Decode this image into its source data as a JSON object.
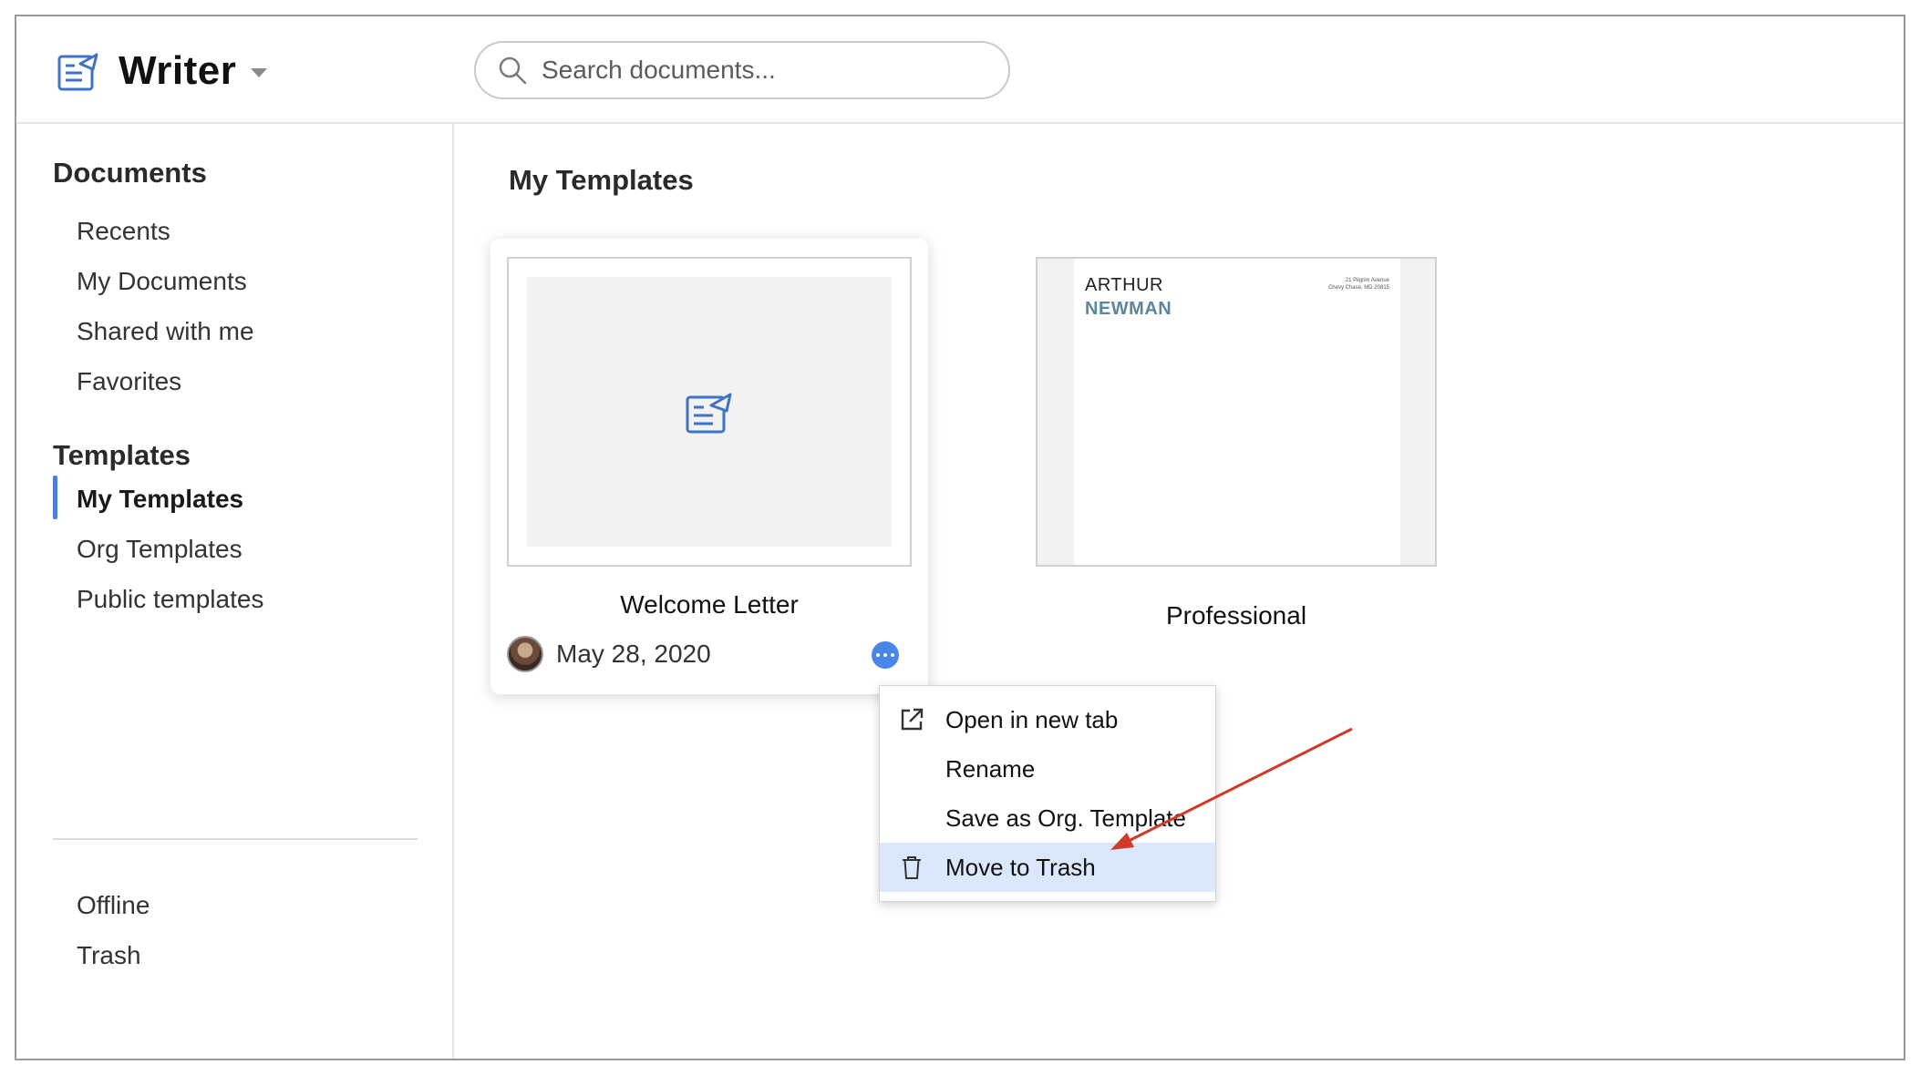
{
  "app": {
    "title": "Writer",
    "accent_color": "#4a7fd6"
  },
  "search": {
    "placeholder": "Search documents..."
  },
  "sidebar": {
    "documents_heading": "Documents",
    "documents_items": [
      {
        "label": "Recents"
      },
      {
        "label": "My Documents"
      },
      {
        "label": "Shared with me"
      },
      {
        "label": "Favorites"
      }
    ],
    "templates_heading": "Templates",
    "templates_items": [
      {
        "label": "My Templates",
        "active": true
      },
      {
        "label": "Org Templates"
      },
      {
        "label": "Public templates"
      }
    ],
    "other_items": [
      {
        "label": "Offline"
      },
      {
        "label": "Trash"
      }
    ]
  },
  "main": {
    "title": "My Templates",
    "cards": [
      {
        "name": "Welcome Letter",
        "date": "May 28, 2020",
        "icon": "document-icon"
      },
      {
        "name": "Professional",
        "preview": {
          "first_name": "ARTHUR",
          "last_name": "NEWMAN",
          "address_line1": "21 Pilgrim Avenue",
          "address_line2": "Chevy Chase, MD 20815"
        }
      }
    ]
  },
  "context_menu": {
    "items": [
      {
        "label": "Open in new tab",
        "icon": "external-link-icon"
      },
      {
        "label": "Rename"
      },
      {
        "label": "Save as Org. Template"
      },
      {
        "label": "Move to Trash",
        "icon": "trash-icon",
        "highlighted": true
      }
    ],
    "highlight_color": "#dbe7fb"
  },
  "annotation": {
    "arrow_color": "#d0392b"
  }
}
